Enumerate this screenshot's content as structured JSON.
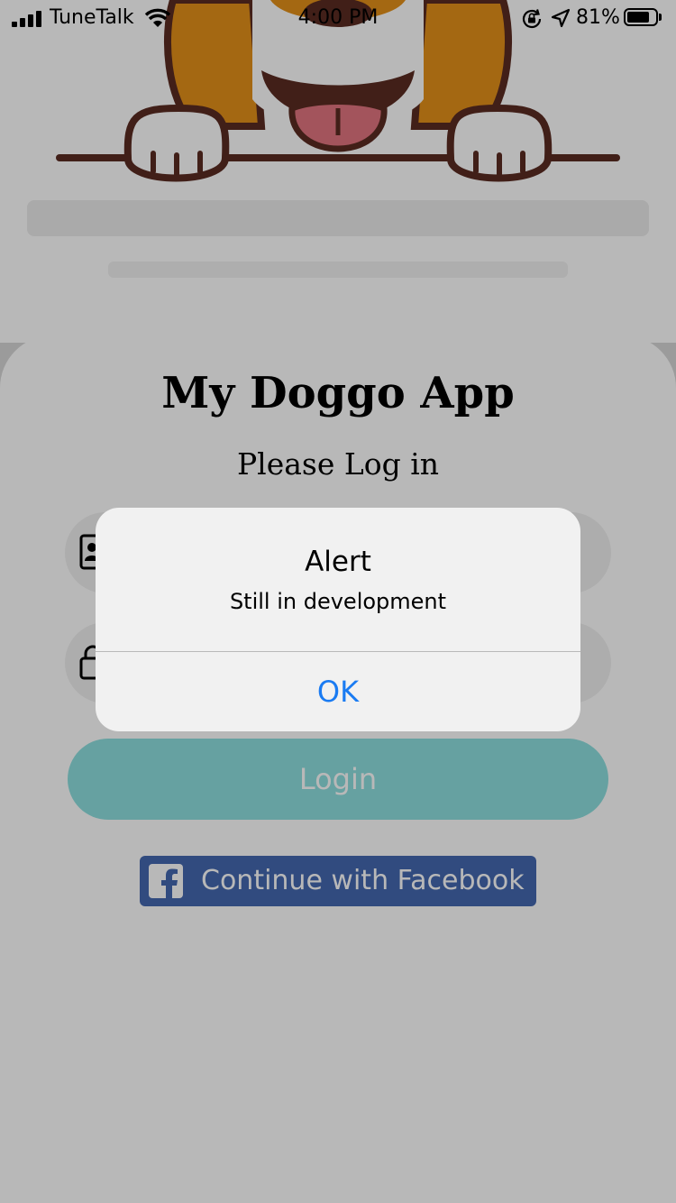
{
  "status_bar": {
    "carrier": "TuneTalk",
    "time": "4:00 PM",
    "battery_percent": "81%",
    "battery_level": 0.81
  },
  "hero": {
    "image": "beagle-dog-illustration"
  },
  "login": {
    "title": "My Doggo App",
    "subtitle": "Please Log in",
    "username_icon": "id-card-icon",
    "password_icon": "lock-icon",
    "login_button": "Login",
    "facebook_button": "Continue with Facebook",
    "colors": {
      "login_button": "#8ee0df",
      "facebook_button": "#4468b0"
    }
  },
  "alert": {
    "title": "Alert",
    "message": "Still in development",
    "ok_button": "OK",
    "button_color": "#1a7bf2"
  }
}
